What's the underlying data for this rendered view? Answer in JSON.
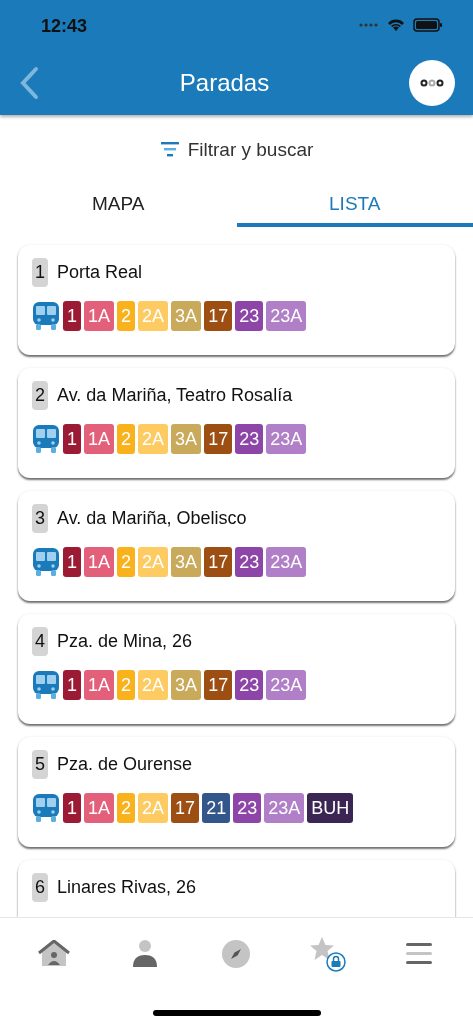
{
  "status_bar": {
    "time": "12:43"
  },
  "header": {
    "title": "Paradas"
  },
  "filter": {
    "label": "Filtrar y buscar"
  },
  "tabs": [
    {
      "label": "MAPA",
      "selected": false
    },
    {
      "label": "LISTA",
      "selected": true
    }
  ],
  "stops": [
    {
      "number": "1",
      "name": "Porta Real",
      "routes": [
        {
          "label": "1",
          "color": "#9b1b35"
        },
        {
          "label": "1A",
          "color": "#e2607a"
        },
        {
          "label": "2",
          "color": "#f9b21b"
        },
        {
          "label": "2A",
          "color": "#fdcb62"
        },
        {
          "label": "3A",
          "color": "#c9a95a"
        },
        {
          "label": "17",
          "color": "#9c4e13"
        },
        {
          "label": "23",
          "color": "#8d45a8"
        },
        {
          "label": "23A",
          "color": "#b07fc7"
        }
      ]
    },
    {
      "number": "2",
      "name": "Av. da Mariña, Teatro Rosalía",
      "routes": [
        {
          "label": "1",
          "color": "#9b1b35"
        },
        {
          "label": "1A",
          "color": "#e2607a"
        },
        {
          "label": "2",
          "color": "#f9b21b"
        },
        {
          "label": "2A",
          "color": "#fdcb62"
        },
        {
          "label": "3A",
          "color": "#c9a95a"
        },
        {
          "label": "17",
          "color": "#9c4e13"
        },
        {
          "label": "23",
          "color": "#8d45a8"
        },
        {
          "label": "23A",
          "color": "#b07fc7"
        }
      ]
    },
    {
      "number": "3",
      "name": "Av. da Mariña, Obelisco",
      "routes": [
        {
          "label": "1",
          "color": "#9b1b35"
        },
        {
          "label": "1A",
          "color": "#e2607a"
        },
        {
          "label": "2",
          "color": "#f9b21b"
        },
        {
          "label": "2A",
          "color": "#fdcb62"
        },
        {
          "label": "3A",
          "color": "#c9a95a"
        },
        {
          "label": "17",
          "color": "#9c4e13"
        },
        {
          "label": "23",
          "color": "#8d45a8"
        },
        {
          "label": "23A",
          "color": "#b07fc7"
        }
      ]
    },
    {
      "number": "4",
      "name": "Pza. de Mina, 26",
      "routes": [
        {
          "label": "1",
          "color": "#9b1b35"
        },
        {
          "label": "1A",
          "color": "#e2607a"
        },
        {
          "label": "2",
          "color": "#f9b21b"
        },
        {
          "label": "2A",
          "color": "#fdcb62"
        },
        {
          "label": "3A",
          "color": "#c9a95a"
        },
        {
          "label": "17",
          "color": "#9c4e13"
        },
        {
          "label": "23",
          "color": "#8d45a8"
        },
        {
          "label": "23A",
          "color": "#b07fc7"
        }
      ]
    },
    {
      "number": "5",
      "name": "Pza. de Ourense",
      "routes": [
        {
          "label": "1",
          "color": "#9b1b35"
        },
        {
          "label": "1A",
          "color": "#e2607a"
        },
        {
          "label": "2",
          "color": "#f9b21b"
        },
        {
          "label": "2A",
          "color": "#fdcb62"
        },
        {
          "label": "17",
          "color": "#9c4e13"
        },
        {
          "label": "21",
          "color": "#33578a"
        },
        {
          "label": "23",
          "color": "#8d45a8"
        },
        {
          "label": "23A",
          "color": "#b07fc7"
        },
        {
          "label": "BUH",
          "color": "#3b2653"
        }
      ]
    },
    {
      "number": "6",
      "name": "Linares Rivas, 26"
    }
  ]
}
